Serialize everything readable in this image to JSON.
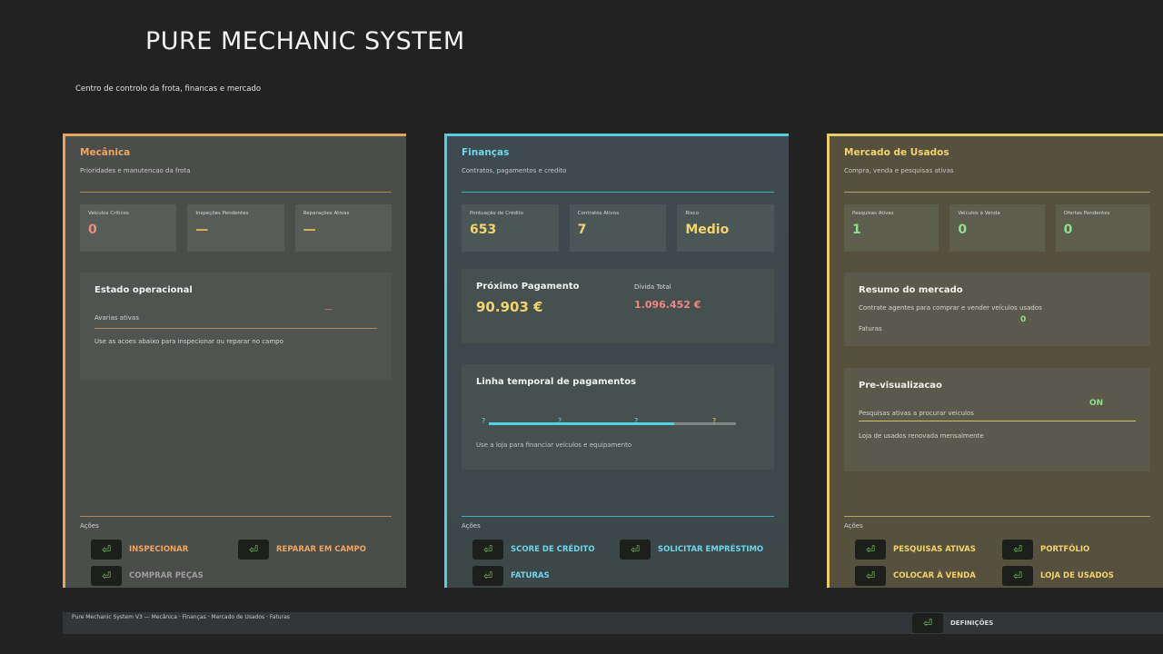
{
  "app": {
    "title": "PURE MECHANIC SYSTEM",
    "subtitle": "Centro de controlo da frota, financas e mercado"
  },
  "colors": {
    "mecanica_accent": "#e3a55d",
    "financas_accent": "#58cbe0",
    "mercado_accent": "#e6cd6a",
    "positive": "#8ee08a",
    "negative": "#f08585"
  },
  "mecanica": {
    "title": "Mecânica",
    "subtitle": "Prioridades e manutencao da frota",
    "stats": [
      {
        "label": "Veículos Críticos",
        "value": "0"
      },
      {
        "label": "Inspeções Pendentes",
        "value": "—"
      },
      {
        "label": "Reparações Ativas",
        "value": "—"
      }
    ],
    "status_card": {
      "title": "Estado operacional",
      "row_label": "Avarias ativas",
      "row_value": "—",
      "note": "Use as acoes abaixo para inspecionar ou reparar no campo"
    },
    "actions_label": "Ações",
    "actions": {
      "inspect": "INSPECIONAR",
      "field_repair": "REPARAR EM CAMPO",
      "buy_parts": "COMPRAR PEÇAS"
    }
  },
  "financas": {
    "title": "Finanças",
    "subtitle": "Contratos, pagamentos e credito",
    "stats": [
      {
        "label": "Pontuação de Crédito",
        "value": "653"
      },
      {
        "label": "Contratos Ativos",
        "value": "7"
      },
      {
        "label": "Risco",
        "value": "Medio"
      }
    ],
    "payment_card": {
      "next_label": "Próximo Pagamento",
      "next_value": "90.903 €",
      "debt_label": "Dívida Total",
      "debt_value": "1.096.452 €"
    },
    "timeline_card": {
      "title": "Linha temporal de pagamentos",
      "progress": 0.75,
      "marks": [
        "?",
        "?",
        "?",
        "?"
      ],
      "note": "Use a loja para financiar veículos e equipamento"
    },
    "actions_label": "Ações",
    "actions": {
      "credit_score": "SCORE DE CRÉDITO",
      "request_loan": "SOLICITAR EMPRÉSTIMO",
      "invoices": "FATURAS"
    }
  },
  "mercado": {
    "title": "Mercado de Usados",
    "subtitle": "Compra, venda e pesquisas ativas",
    "stats": [
      {
        "label": "Pesquisas Ativas",
        "value": "1"
      },
      {
        "label": "Veículos à Venda",
        "value": "0"
      },
      {
        "label": "Ofertas Pendentes",
        "value": "0"
      }
    ],
    "summary_card": {
      "title": "Resumo do mercado",
      "note": "Contrate agentes para comprar e vender veículos usados",
      "invoices_label": "Faturas",
      "invoices_value": "0"
    },
    "preview_card": {
      "title": "Pre-visualizacao",
      "search_label": "Pesquisas ativas a procurar veiculos",
      "search_state": "ON",
      "note": "Loja de usados renovada mensalmente"
    },
    "actions_label": "Ações",
    "actions": {
      "active_searches": "PESQUISAS ATIVAS",
      "portfolio": "PORTFÓLIO",
      "put_on_sale": "COLOCAR À VENDA",
      "used_shop": "LOJA DE USADOS"
    }
  },
  "footer": {
    "text": "Pure Mechanic System V3 — Mecânica · Finanças · Mercado de Usados · Faturas",
    "settings": "DEFINIÇÕES"
  },
  "icons": {
    "action": "enter-arrow-icon"
  }
}
